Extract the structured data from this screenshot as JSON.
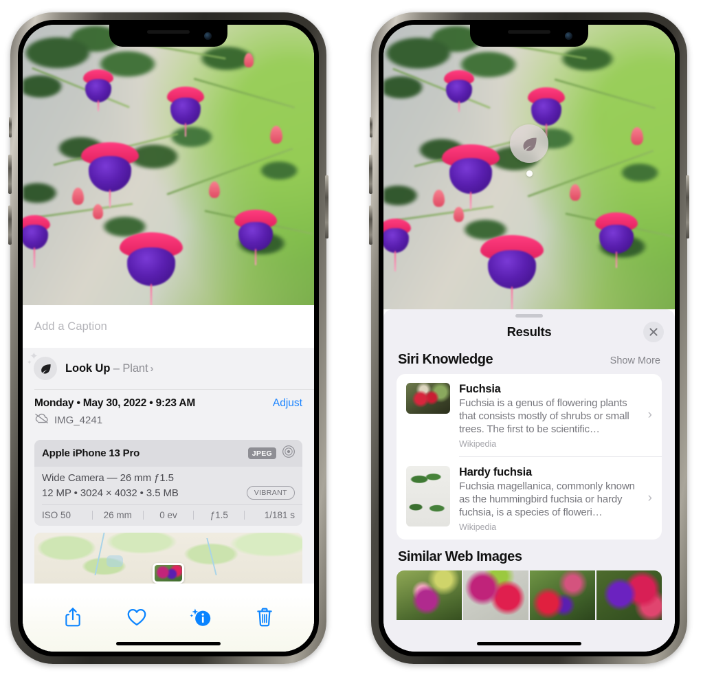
{
  "left_phone": {
    "caption": {
      "placeholder": "Add a Caption",
      "value": ""
    },
    "look_up": {
      "label": "Look Up",
      "dash": " – ",
      "subject": "Plant",
      "chevron": "›",
      "icon": "leaf-icon"
    },
    "meta": {
      "date_line": "Monday • May 30, 2022 • 9:23 AM",
      "adjust_label": "Adjust",
      "filename": "IMG_4241",
      "cloud_icon": "icloud-slash-icon"
    },
    "exif": {
      "device": "Apple iPhone 13 Pro",
      "format_badge": "JPEG",
      "aperture_icon": "aperture-icon",
      "lens_line": "Wide Camera — 26 mm ƒ1.5",
      "details_line": "12 MP • 3024 × 4032 • 3.5 MB",
      "style_badge": "VIBRANT",
      "stats": [
        "ISO 50",
        "26 mm",
        "0 ev",
        "ƒ1.5",
        "1/181 s"
      ]
    },
    "toolbar": [
      {
        "name": "share-button",
        "icon": "share-icon"
      },
      {
        "name": "favorite-button",
        "icon": "heart-icon"
      },
      {
        "name": "info-button",
        "icon": "info-sparkle-icon"
      },
      {
        "name": "delete-button",
        "icon": "trash-icon"
      }
    ]
  },
  "right_phone": {
    "visual_lookup_badge": {
      "icon": "leaf-icon"
    },
    "sheet": {
      "title": "Results",
      "close_icon": "close-icon",
      "grabber": "drag-handle"
    },
    "siri_knowledge": {
      "heading": "Siri Knowledge",
      "show_more": "Show More",
      "results": [
        {
          "title": "Fuchsia",
          "description": "Fuchsia is a genus of flowering plants that consists mostly of shrubs or small trees. The first to be scientific…",
          "source": "Wikipedia",
          "chevron": "›"
        },
        {
          "title": "Hardy fuchsia",
          "description": "Fuchsia magellanica, commonly known as the hummingbird fuchsia or hardy fuchsia, is a species of floweri…",
          "source": "Wikipedia",
          "chevron": "›"
        }
      ]
    },
    "similar_web_images": {
      "heading": "Similar Web Images",
      "count": 4
    }
  },
  "colors": {
    "accent_blue": "#1b84ff",
    "sheet_bg": "#f0eff4",
    "card_bg": "#ffffff",
    "secondary_text": "#86868c",
    "exif_card": "#e6e6e9"
  }
}
